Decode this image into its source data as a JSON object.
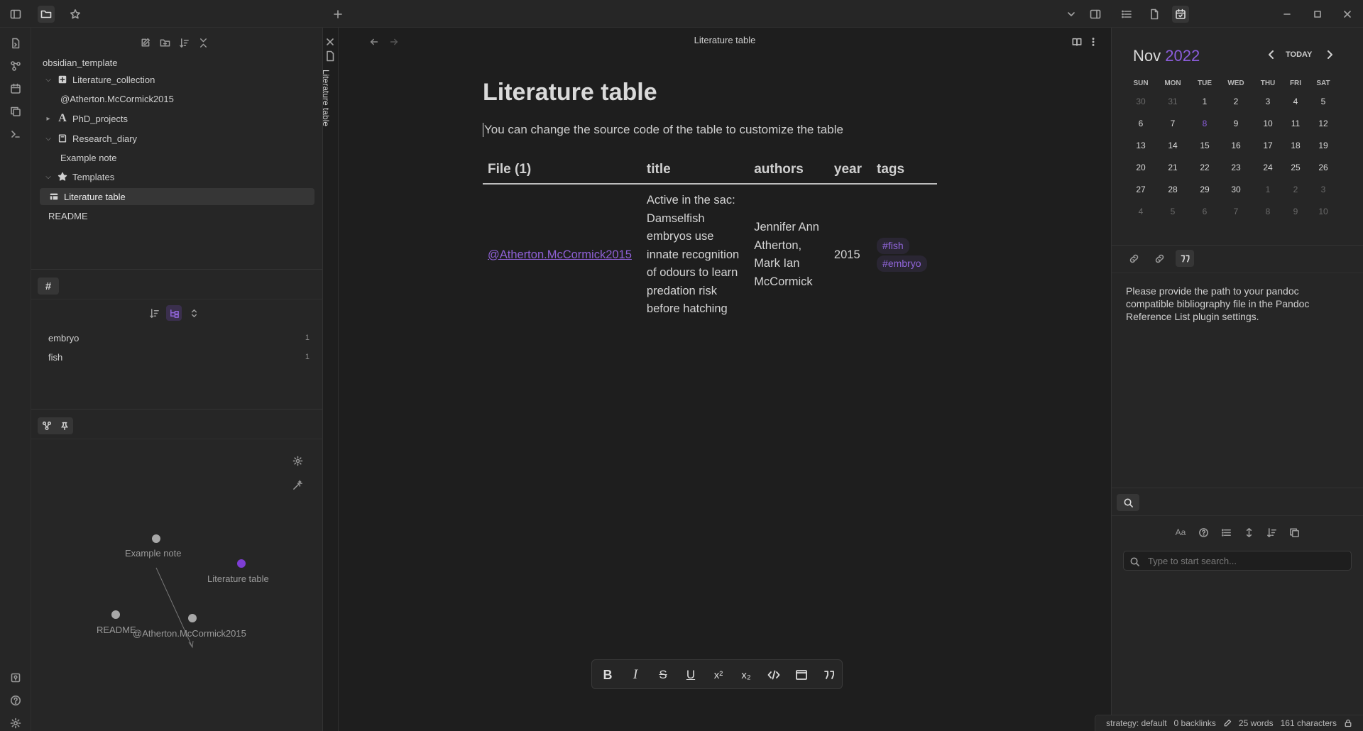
{
  "window": {
    "title": "Literature table"
  },
  "file_tree": {
    "vault_name": "obsidian_template",
    "items": [
      {
        "label": "Literature_collection",
        "icon": "plus-square-icon",
        "expanded": true
      },
      {
        "label": "@Atherton.McCormick2015"
      },
      {
        "label": "PhD_projects",
        "icon": "letter-a-icon",
        "expanded": false
      },
      {
        "label": "Research_diary",
        "icon": "book-icon",
        "expanded": true
      },
      {
        "label": "Example note"
      },
      {
        "label": "Templates",
        "icon": "star-icon",
        "expanded": true
      },
      {
        "label": "Literature table",
        "icon": "table-icon",
        "selected": true
      },
      {
        "label": "README"
      }
    ]
  },
  "tags_pane": {
    "tab_label": "#",
    "tags": [
      {
        "name": "embryo",
        "count": "1"
      },
      {
        "name": "fish",
        "count": "1"
      }
    ]
  },
  "graph": {
    "nodes": [
      {
        "label": "Example note"
      },
      {
        "label": "Literature table",
        "color": "#7e3ed4"
      },
      {
        "label": "README"
      },
      {
        "label": "@Atherton.McCormick2015"
      }
    ]
  },
  "editor": {
    "view_title": "Literature table",
    "vertical_tab_label": "Literature table",
    "note_title": "Literature table",
    "paragraph": "You can change the source code of the table to customize the table",
    "table": {
      "headers": [
        "File (1)",
        "title",
        "authors",
        "year",
        "tags"
      ],
      "row": {
        "file": "@Atherton.McCormick2015",
        "title_lines": [
          "Active in the sac:",
          "Damselfish",
          "embryos use",
          "innate recognition",
          "of odours to learn",
          "predation risk",
          "before hatching"
        ],
        "author_lines": [
          "Jennifer Ann",
          "Atherton,",
          "Mark Ian",
          "McCormick"
        ],
        "year": "2015",
        "tags": [
          "#fish",
          "#embryo"
        ]
      }
    }
  },
  "format_toolbar": {
    "buttons": [
      "bold-icon",
      "italic-icon",
      "strikethrough-icon",
      "underline-icon",
      "superscript-icon",
      "subscript-icon",
      "code-icon",
      "embed-icon",
      "quote-icon"
    ],
    "bold_glyph": "B",
    "italic_glyph": "I",
    "strike_glyph": "S",
    "underline_glyph": "U",
    "sup_glyph": "x²",
    "sub_glyph": "x₂"
  },
  "calendar": {
    "month": "Nov",
    "year": "2022",
    "today_label": "TODAY",
    "weekdays": [
      "SUN",
      "MON",
      "TUE",
      "WED",
      "THU",
      "FRI",
      "SAT"
    ],
    "weeks": [
      [
        "30",
        "31",
        "1",
        "2",
        "3",
        "4",
        "5"
      ],
      [
        "6",
        "7",
        "8",
        "9",
        "10",
        "11",
        "12"
      ],
      [
        "13",
        "14",
        "15",
        "16",
        "17",
        "18",
        "19"
      ],
      [
        "20",
        "21",
        "22",
        "23",
        "24",
        "25",
        "26"
      ],
      [
        "27",
        "28",
        "29",
        "30",
        "1",
        "2",
        "3"
      ],
      [
        "4",
        "5",
        "6",
        "7",
        "8",
        "9",
        "10"
      ]
    ],
    "today": "8",
    "accent_color": "#8b5ddb"
  },
  "reference_list": {
    "message": "Please provide the path to your pandoc compatible bibliography file in the Pandoc Reference List plugin settings."
  },
  "search": {
    "placeholder": "Type to start search..."
  },
  "status_bar": {
    "strategy": "strategy: default",
    "backlinks": "0 backlinks",
    "words": "25 words",
    "characters": "161 characters"
  }
}
